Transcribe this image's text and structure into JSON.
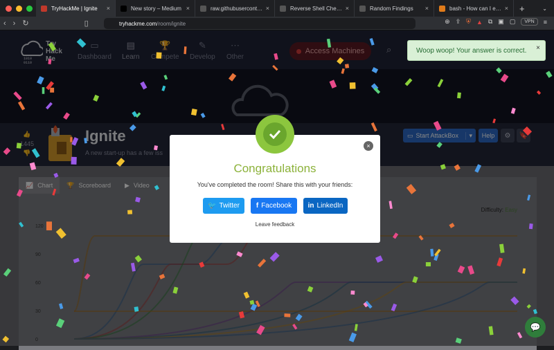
{
  "browser": {
    "tabs": [
      {
        "title": "TryHackMe | Ignite",
        "favicon_color": "#c0392b",
        "active": true
      },
      {
        "title": "New story – Medium",
        "favicon_color": "#000000",
        "active": false
      },
      {
        "title": "raw.githubusercontent.com",
        "favicon_color": "#555555",
        "active": false
      },
      {
        "title": "Reverse Shell Cheat Sheet |",
        "favicon_color": "#555555",
        "active": false
      },
      {
        "title": "Random Findings",
        "favicon_color": "#555555",
        "active": false
      },
      {
        "title": "bash - How can I exclude al",
        "favicon_color": "#e07b1a",
        "active": false
      }
    ],
    "url_host": "tryhackme.com",
    "url_path": "/room/ignite",
    "vpn_label": "VPN",
    "shield_count": "15"
  },
  "site": {
    "logo_text": "Try\nHack\nMe",
    "logo_bits": "10  10\n1110  1\n0101  0\n1101",
    "nav": [
      {
        "label": "Dashboard",
        "icon": "dashboard-icon",
        "glyph": "▭"
      },
      {
        "label": "Learn",
        "icon": "book-icon",
        "glyph": "▤"
      },
      {
        "label": "Compete",
        "icon": "trophy-icon",
        "glyph": "🏆"
      },
      {
        "label": "Develop",
        "icon": "pencil-icon",
        "glyph": "✎"
      },
      {
        "label": "Other",
        "icon": "dots-icon",
        "glyph": "⋯"
      }
    ],
    "access_machines": "Access Machines"
  },
  "room": {
    "title": "Ignite",
    "description": "A new start-up has a few iss",
    "votes": "1445",
    "start_attackbox": "Start AttackBox",
    "help": "Help"
  },
  "content": {
    "tabs": [
      "Chart",
      "Scoreboard",
      "Video"
    ],
    "difficulty_label": "Difficulty:",
    "difficulty_value": "Easy"
  },
  "modal": {
    "title": "Congratulations",
    "subtitle": "You've completed the room! Share this with your friends:",
    "twitter": "Twitter",
    "facebook": "Facebook",
    "linkedin": "LinkedIn",
    "feedback": "Leave feedback",
    "close": "×"
  },
  "toast": {
    "message": "Woop woop! Your answer is correct.",
    "close": "×"
  },
  "colors": {
    "twitter": "#1d9bf0",
    "facebook": "#1877f2",
    "linkedin": "#0a66c2",
    "success": "#8cc63e"
  },
  "chart_data": {
    "type": "line",
    "yticks": [
      "120",
      "90",
      "60",
      "30",
      "0"
    ],
    "series_colors": [
      "#a06a1a",
      "#2f5f8a",
      "#a33a3a",
      "#2f7a3a",
      "#6a3a8a",
      "#2b5f7a",
      "#b08020"
    ]
  }
}
